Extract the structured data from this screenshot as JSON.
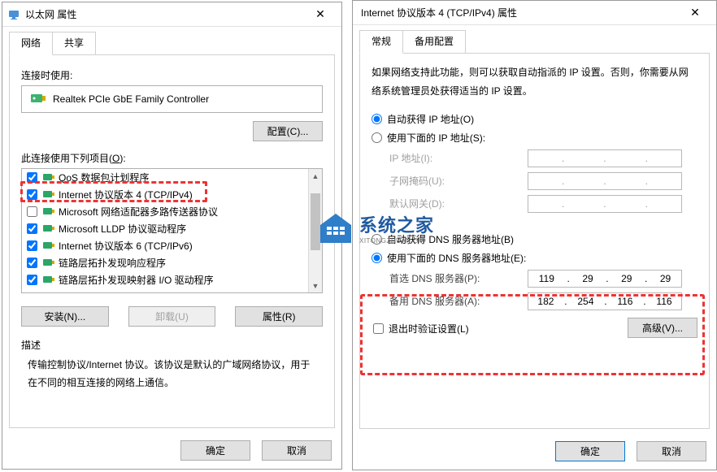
{
  "left": {
    "title": "以太网 属性",
    "tabs": {
      "network": "网络",
      "share": "共享"
    },
    "connect_using": "连接时使用:",
    "adapter": "Realtek PCIe GbE Family Controller",
    "configure_btn": "配置(C)...",
    "uses_label_a": "此连接使用下列项目(",
    "uses_label_u": "O",
    "uses_label_b": "):",
    "items": [
      {
        "checked": true,
        "label": "QoS 数据包计划程序"
      },
      {
        "checked": true,
        "label": "Internet 协议版本 4 (TCP/IPv4)"
      },
      {
        "checked": false,
        "label": "Microsoft 网络适配器多路传送器协议"
      },
      {
        "checked": true,
        "label": "Microsoft LLDP 协议驱动程序"
      },
      {
        "checked": true,
        "label": "Internet 协议版本 6 (TCP/IPv6)"
      },
      {
        "checked": true,
        "label": "链路层拓扑发现响应程序"
      },
      {
        "checked": true,
        "label": "链路层拓扑发现映射器 I/O 驱动程序"
      }
    ],
    "install_btn": "安装(N)...",
    "uninstall_btn": "卸载(U)",
    "properties_btn": "属性(R)",
    "desc_title": "描述",
    "desc_body": "传输控制协议/Internet 协议。该协议是默认的广域网络协议，用于在不同的相互连接的网络上通信。",
    "ok": "确定",
    "cancel": "取消"
  },
  "right": {
    "title": "Internet 协议版本 4 (TCP/IPv4) 属性",
    "tabs": {
      "general": "常规",
      "alt": "备用配置"
    },
    "intro": "如果网络支持此功能，则可以获取自动指派的 IP 设置。否则，你需要从网络系统管理员处获得适当的 IP 设置。",
    "ip_auto": "自动获得 IP 地址(O)",
    "ip_manual": "使用下面的 IP 地址(S):",
    "ip_addr_label": "IP 地址(I):",
    "mask_label": "子网掩码(U):",
    "gw_label": "默认网关(D):",
    "dns_auto": "自动获得 DNS 服务器地址(B)",
    "dns_manual": "使用下面的 DNS 服务器地址(E):",
    "dns1_label": "首选 DNS 服务器(P):",
    "dns2_label": "备用 DNS 服务器(A):",
    "dns1": [
      "119",
      "29",
      "29",
      "29"
    ],
    "dns2": [
      "182",
      "254",
      "116",
      "116"
    ],
    "validate": "退出时验证设置(L)",
    "advanced_btn": "高级(V)...",
    "ok": "确定",
    "cancel": "取消"
  },
  "watermark": {
    "line1": "系统之家",
    "line2": "XITONGZHUAN    OM"
  }
}
